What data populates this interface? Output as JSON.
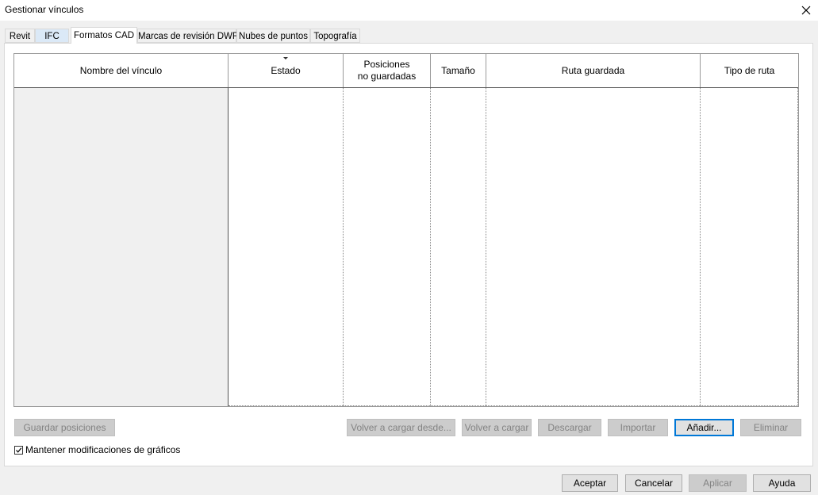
{
  "window": {
    "title": "Gestionar vínculos",
    "close_glyph": "✕"
  },
  "tabs": [
    {
      "label": "Revit"
    },
    {
      "label": "IFC"
    },
    {
      "label": "Formatos CAD",
      "active": true
    },
    {
      "label": "Marcas de revisión DWF"
    },
    {
      "label": "Nubes de puntos"
    },
    {
      "label": "Topografía"
    }
  ],
  "table": {
    "columns": [
      {
        "label": "Nombre del vínculo"
      },
      {
        "label": "Estado",
        "sorted": true
      },
      {
        "label": "Posiciones\nno guardadas"
      },
      {
        "label": "Tamaño"
      },
      {
        "label": "Ruta guardada"
      },
      {
        "label": "Tipo de ruta"
      }
    ],
    "rows": []
  },
  "actions": {
    "save_positions": "Guardar posiciones",
    "reload_from": "Volver a cargar desde...",
    "reload": "Volver a cargar",
    "unload": "Descargar",
    "import": "Importar",
    "add": "Añadir...",
    "remove": "Eliminar"
  },
  "options": {
    "keep_graphic_overrides": {
      "label": "Mantener modificaciones de gráficos",
      "checked": true
    }
  },
  "footer": {
    "ok": "Aceptar",
    "cancel": "Cancelar",
    "apply": "Aplicar",
    "help": "Ayuda"
  }
}
